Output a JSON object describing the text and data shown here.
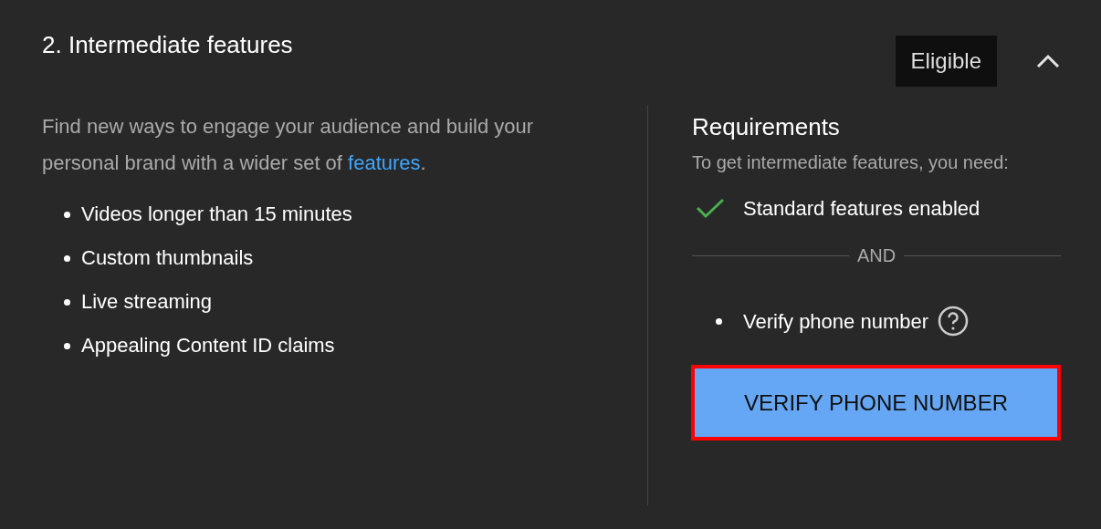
{
  "section": {
    "title": "2. Intermediate features",
    "badge": "Eligible",
    "expanded": true
  },
  "description": {
    "text": "Find new ways to engage your audience and build your personal brand with a wider set of ",
    "link": "features",
    "end": "."
  },
  "features": [
    "Videos longer than 15 minutes",
    "Custom thumbnails",
    "Live streaming",
    "Appealing Content ID claims"
  ],
  "requirements": {
    "title": "Requirements",
    "subtitle": "To get intermediate features, you need:",
    "items": [
      {
        "kind": "done",
        "label": "Standard features enabled"
      },
      {
        "kind": "separator",
        "label": "AND"
      },
      {
        "kind": "todo",
        "label": "Verify phone number"
      }
    ],
    "button": {
      "label": "VERIFY PHONE NUMBER",
      "highlighted": true
    }
  }
}
